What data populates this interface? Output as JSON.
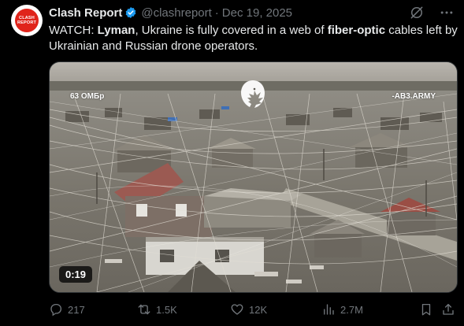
{
  "account": {
    "display_name": "Clash Report",
    "handle": "@clashreport",
    "separator": "·",
    "date": "Dec 19, 2025",
    "avatar_line1": "CLASH",
    "avatar_line2": "REPORT",
    "avatar_color": "#e0241b",
    "verified_color": "#1d9bf0"
  },
  "top_icons": [
    "grok-icon",
    "more-icon"
  ],
  "tweet": {
    "p1": "WATCH: ",
    "b1": "Lyman",
    "p2": ", Ukraine is fully covered in a web of ",
    "b2": "fiber-optic",
    "p3": " cables left by Ukrainian and Russian drone operators."
  },
  "media": {
    "watermark_left": "63 ОМБр",
    "watermark_right": "-AB3.ARMY",
    "duration": "0:19"
  },
  "actions": {
    "replies": "217",
    "reposts": "1.5K",
    "likes": "12K",
    "views": "2.7M"
  },
  "colors": {
    "background": "#000000",
    "text": "#e7e9ea",
    "muted": "#71767b"
  }
}
